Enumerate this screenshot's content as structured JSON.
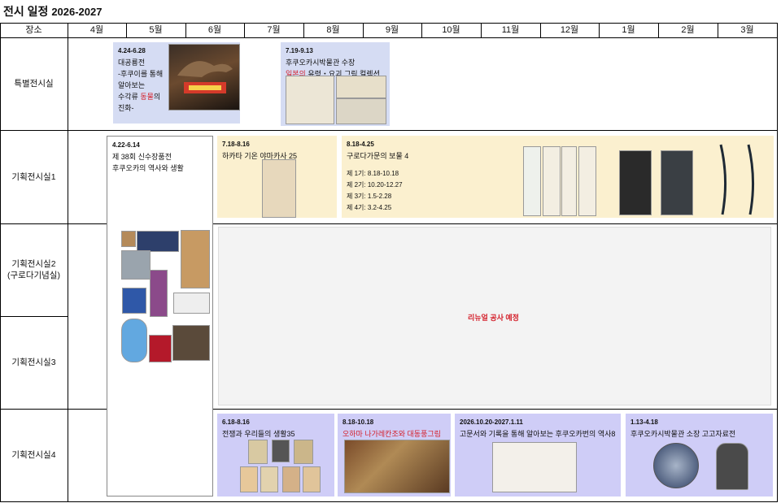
{
  "title": "전시 일정",
  "year_range": "2026-2027",
  "header": {
    "place": "장소",
    "months": [
      "4월",
      "5월",
      "6월",
      "7월",
      "8월",
      "9월",
      "10월",
      "11월",
      "12월",
      "1월",
      "2월",
      "3월"
    ]
  },
  "venues": [
    "특별전시실",
    "기획전시실1",
    "기획전시실2\n(구로다기념실)",
    "기획전시실3",
    "기획전시실4"
  ],
  "exhibitions": {
    "dinosaur": {
      "date": "4.24-6.28",
      "lines": [
        "대공룡전",
        "-후쿠이를 통해",
        "알아보는",
        "수각류 동물의",
        "진화-"
      ],
      "highlight": "동물"
    },
    "yokai": {
      "date": "7.19-9.13",
      "line1": "후쿠오카시박물관 수장",
      "line2_red": "일본의",
      "line2_rest": " 유령・요괴 그림 컬렉션"
    },
    "collections": {
      "date": "4.22-6.14",
      "line1": "제 38회 신수장품전",
      "line2": "후쿠오카의 역사와 생활"
    },
    "yamakasa": {
      "date": "7.18-8.16",
      "title": "하카타 기온 야마카사 25"
    },
    "kuroda": {
      "date": "8.18-4.25",
      "title": "구로다가문의 보물 4",
      "terms": [
        "제 1기: 8.18-10.18",
        "제 2기: 10.20-12.27",
        "제 3기: 1.5-2.28",
        "제 4기: 3.2-4.25"
      ]
    },
    "renewal": "리뉴얼 공사 예정",
    "war": {
      "date": "6.18-8.16",
      "title": "전쟁과 우리들의 생활35"
    },
    "namban": {
      "date": "8.18-10.18",
      "title": "오하마 나가레칸조와 대동풍그림"
    },
    "documents": {
      "date": "2026.10.20-2027.1.11",
      "title": "고문서와 기록을 통해 알아보는 후쿠오카번의 역사8"
    },
    "archaeology": {
      "date": "1.13-4.18",
      "title": "후쿠오카시박물관 소장 고고자료전"
    }
  },
  "colors": {
    "special": "#d5dcf3",
    "planned": "#fbf0cf",
    "room4": "#cfcdf7",
    "renewal_text": "#d4202b",
    "renewal_bg": "#f3f3f3"
  }
}
